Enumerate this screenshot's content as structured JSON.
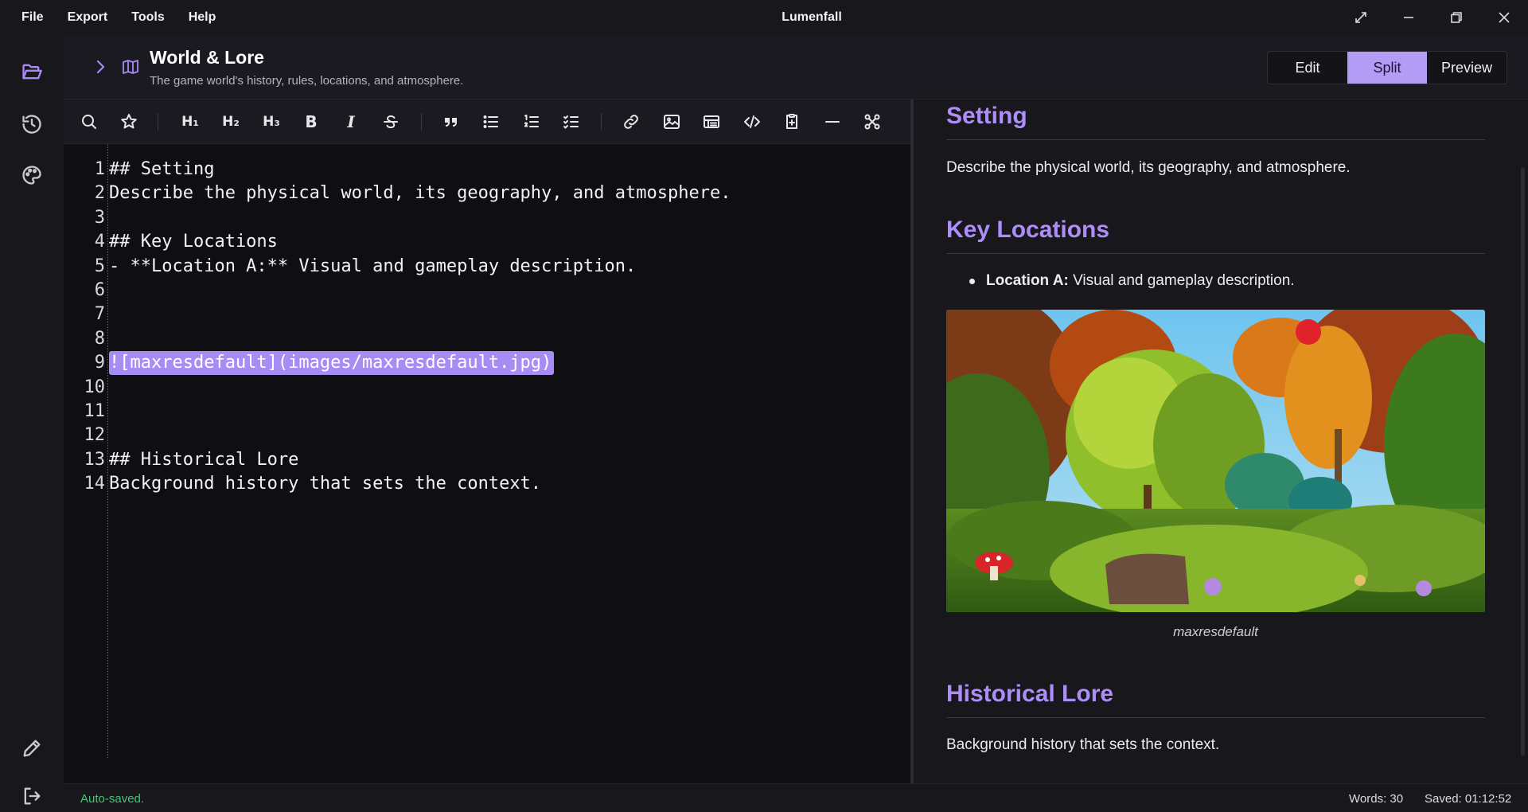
{
  "menu": {
    "file": "File",
    "export": "Export",
    "tools": "Tools",
    "help": "Help"
  },
  "app": {
    "title": "Lumenfall"
  },
  "header": {
    "title": "World & Lore",
    "subtitle": "The game world's history, rules, locations, and atmosphere.",
    "modes": {
      "edit": "Edit",
      "split": "Split",
      "preview": "Preview",
      "active": "Split"
    }
  },
  "colors": {
    "accent": "#b39cf6",
    "heading": "#ad8ef8",
    "saved_status": "#3fca76"
  },
  "rail": {
    "icons": [
      "folder-open-icon",
      "history-icon",
      "palette-icon",
      "pencil-icon",
      "logout-icon"
    ]
  },
  "toolbar": {
    "h1": "H₁",
    "h2": "H₂",
    "h3": "H₃",
    "bold": "B",
    "italic": "I"
  },
  "editor": {
    "lines": [
      {
        "n": "1",
        "text": "## Setting"
      },
      {
        "n": "2",
        "text": "Describe the physical world, its geography, and atmosphere."
      },
      {
        "n": "3",
        "text": ""
      },
      {
        "n": "4",
        "text": "## Key Locations"
      },
      {
        "n": "5",
        "text": "- **Location A:** Visual and gameplay description."
      },
      {
        "n": "6",
        "text": ""
      },
      {
        "n": "7",
        "text": ""
      },
      {
        "n": "8",
        "text": ""
      },
      {
        "n": "9",
        "text": "![maxresdefault](images/maxresdefault.jpg)"
      },
      {
        "n": "10",
        "text": ""
      },
      {
        "n": "11",
        "text": ""
      },
      {
        "n": "12",
        "text": ""
      },
      {
        "n": "13",
        "text": "## Historical Lore"
      },
      {
        "n": "14",
        "text": "Background history that sets the context."
      }
    ]
  },
  "preview": {
    "setting_heading": "Setting",
    "setting_text": "Describe the physical world, its geography, and atmosphere.",
    "locations_heading": "Key Locations",
    "location_a_label": "Location A:",
    "location_a_text": "Visual and gameplay description.",
    "image_caption": "maxresdefault",
    "lore_heading": "Historical Lore",
    "lore_text": "Background history that sets the context."
  },
  "status": {
    "left": "Auto-saved.",
    "words": "Words: 30",
    "saved": "Saved: 01:12:52"
  }
}
